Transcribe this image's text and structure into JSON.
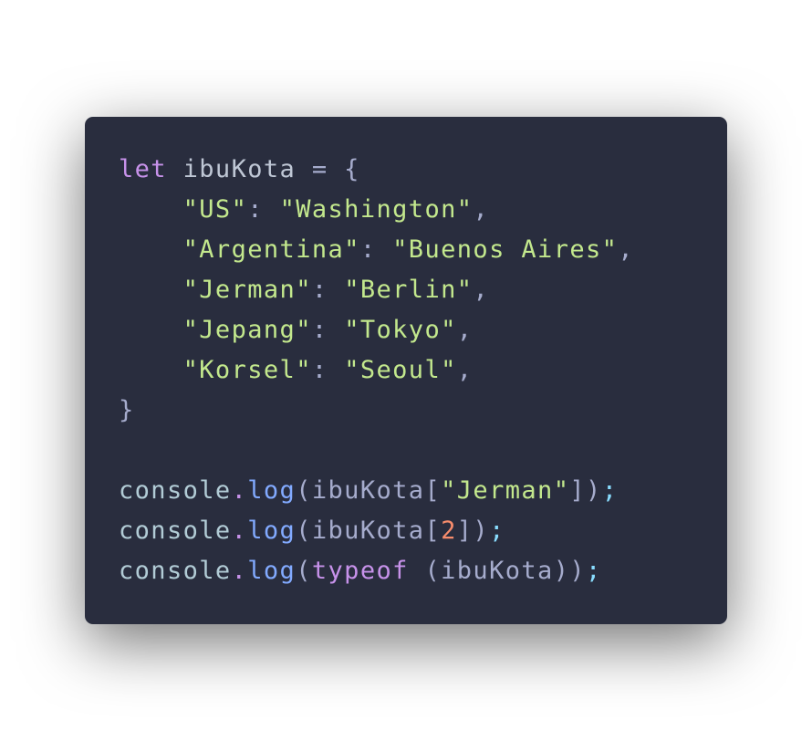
{
  "code": {
    "lines": [
      [
        [
          "let",
          "kw"
        ],
        [
          " ibuKota ",
          "var"
        ],
        [
          "=",
          "pun"
        ],
        [
          " {",
          "pun"
        ]
      ],
      [
        [
          "    ",
          "pun"
        ],
        [
          "\"US\"",
          "str"
        ],
        [
          ": ",
          "pun"
        ],
        [
          "\"Washington\"",
          "str"
        ],
        [
          ",",
          "pun"
        ]
      ],
      [
        [
          "    ",
          "pun"
        ],
        [
          "\"Argentina\"",
          "str"
        ],
        [
          ": ",
          "pun"
        ],
        [
          "\"Buenos Aires\"",
          "str"
        ],
        [
          ",",
          "pun"
        ]
      ],
      [
        [
          "    ",
          "pun"
        ],
        [
          "\"Jerman\"",
          "str"
        ],
        [
          ": ",
          "pun"
        ],
        [
          "\"Berlin\"",
          "str"
        ],
        [
          ",",
          "pun"
        ]
      ],
      [
        [
          "    ",
          "pun"
        ],
        [
          "\"Jepang\"",
          "str"
        ],
        [
          ": ",
          "pun"
        ],
        [
          "\"Tokyo\"",
          "str"
        ],
        [
          ",",
          "pun"
        ]
      ],
      [
        [
          "    ",
          "pun"
        ],
        [
          "\"Korsel\"",
          "str"
        ],
        [
          ": ",
          "pun"
        ],
        [
          "\"Seoul\"",
          "str"
        ],
        [
          ",",
          "pun"
        ]
      ],
      [
        [
          "}",
          "pun"
        ]
      ],
      [],
      [
        [
          "console",
          "obj"
        ],
        [
          ".",
          "dot"
        ],
        [
          "log",
          "fn"
        ],
        [
          "(ibuKota[",
          "pun"
        ],
        [
          "\"Jerman\"",
          "str"
        ],
        [
          "])",
          "pun"
        ],
        [
          ";",
          "semi"
        ]
      ],
      [
        [
          "console",
          "obj"
        ],
        [
          ".",
          "dot"
        ],
        [
          "log",
          "fn"
        ],
        [
          "(ibuKota[",
          "pun"
        ],
        [
          "2",
          "num"
        ],
        [
          "])",
          "pun"
        ],
        [
          ";",
          "semi"
        ]
      ],
      [
        [
          "console",
          "obj"
        ],
        [
          ".",
          "dot"
        ],
        [
          "log",
          "fn"
        ],
        [
          "(",
          "pun"
        ],
        [
          "typeof",
          "kw"
        ],
        [
          " (ibuKota))",
          "pun"
        ],
        [
          ";",
          "semi"
        ]
      ]
    ]
  },
  "colors": {
    "background": "#292d3e",
    "keyword": "#c792ea",
    "string": "#c3e88d",
    "function": "#82aaff",
    "number": "#f78c6c",
    "punctuation": "#a6accd"
  }
}
